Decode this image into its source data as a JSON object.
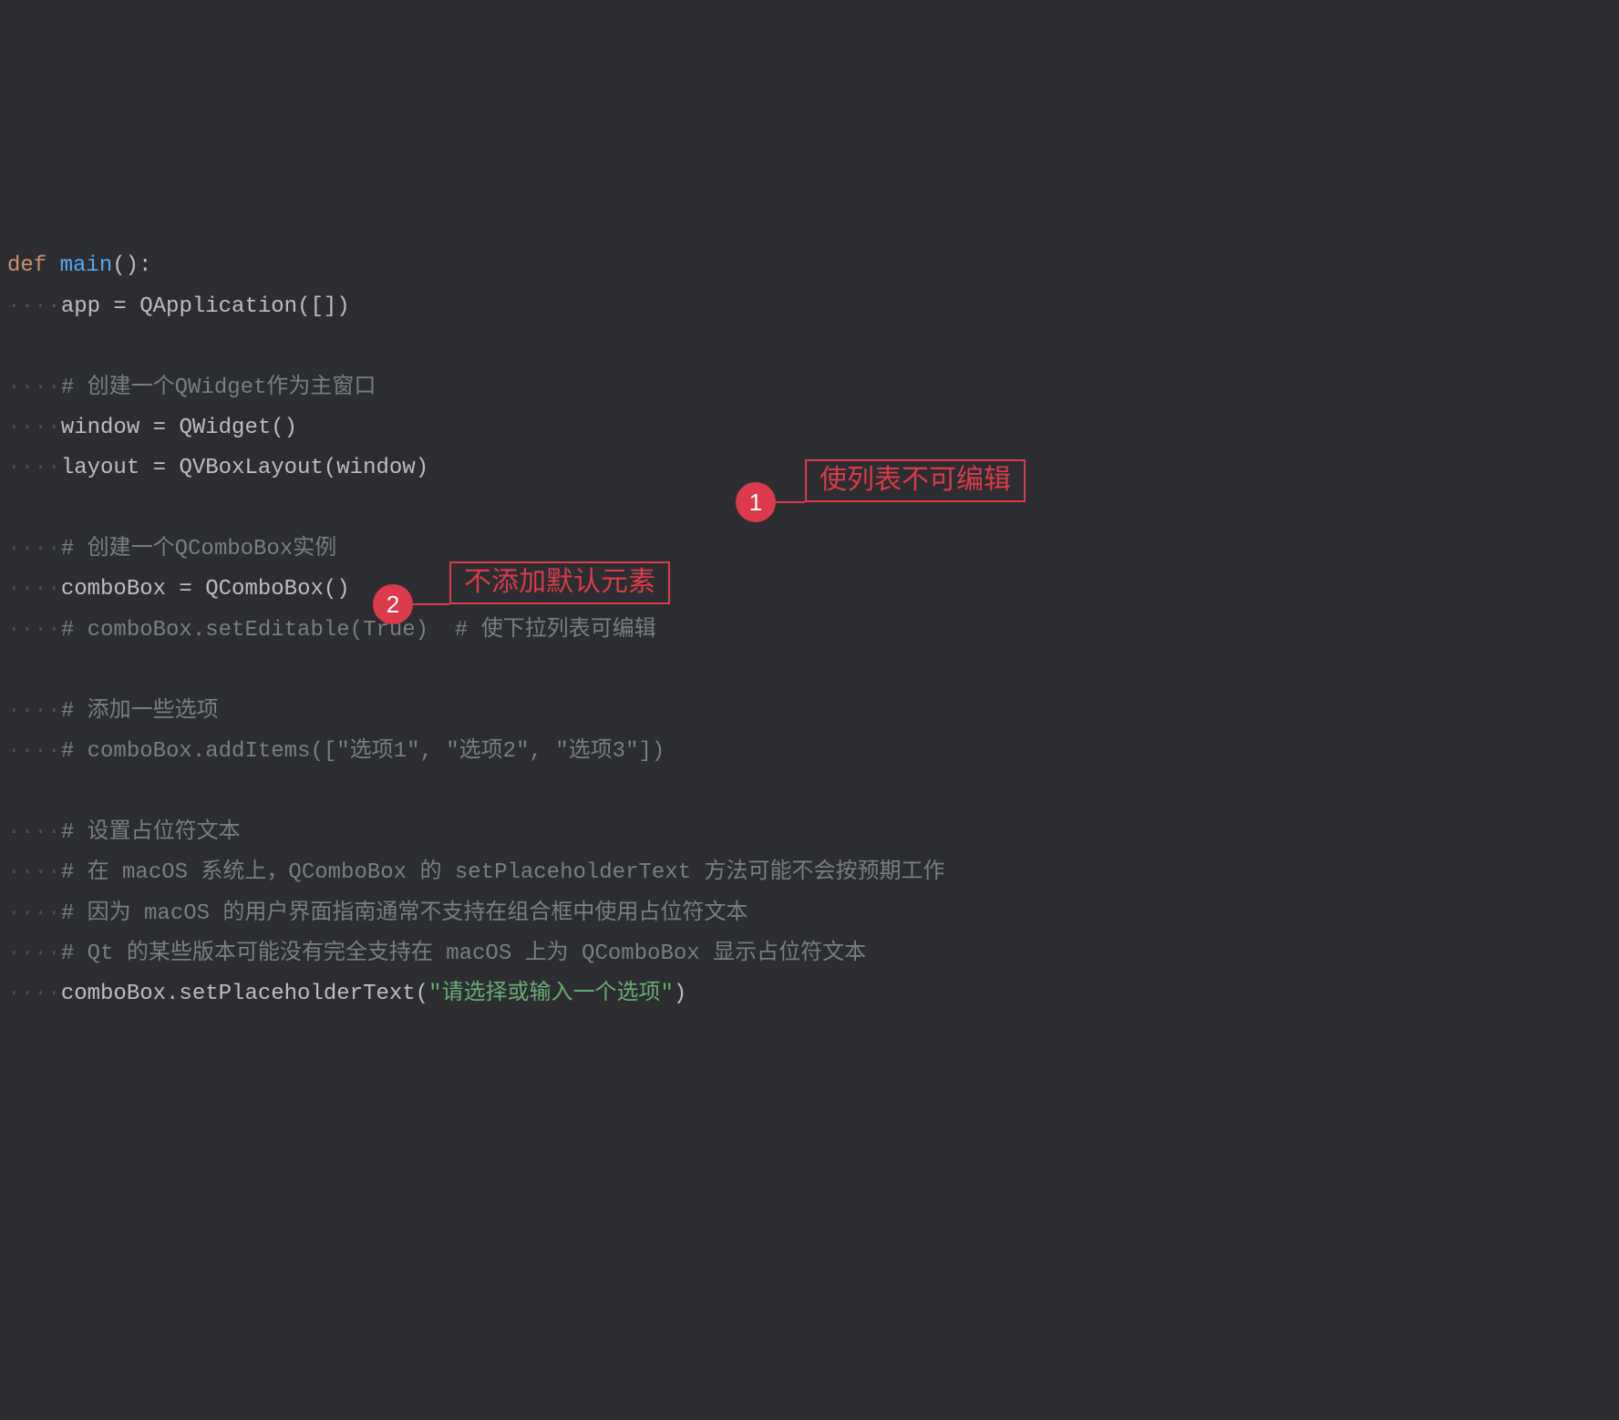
{
  "code": {
    "lines": [
      {
        "indent": 0,
        "tokens": [
          {
            "t": "keyword",
            "v": "def "
          },
          {
            "t": "funcname",
            "v": "main"
          },
          {
            "t": "paren",
            "v": "():"
          }
        ]
      },
      {
        "indent": 1,
        "tokens": [
          {
            "t": "plain",
            "v": "app = "
          },
          {
            "t": "classname",
            "v": "QApplication"
          },
          {
            "t": "paren",
            "v": "([])"
          }
        ]
      },
      {
        "indent": 0,
        "tokens": []
      },
      {
        "indent": 1,
        "tokens": [
          {
            "t": "comment",
            "v": "# 创建一个QWidget作为主窗口"
          }
        ]
      },
      {
        "indent": 1,
        "tokens": [
          {
            "t": "plain",
            "v": "window = "
          },
          {
            "t": "classname",
            "v": "QWidget"
          },
          {
            "t": "paren",
            "v": "()"
          }
        ]
      },
      {
        "indent": 1,
        "tokens": [
          {
            "t": "plain",
            "v": "layout = "
          },
          {
            "t": "classname",
            "v": "QVBoxLayout"
          },
          {
            "t": "paren",
            "v": "(window)"
          }
        ]
      },
      {
        "indent": 0,
        "tokens": []
      },
      {
        "indent": 1,
        "tokens": [
          {
            "t": "comment",
            "v": "# 创建一个QComboBox实例"
          }
        ]
      },
      {
        "indent": 1,
        "tokens": [
          {
            "t": "plain",
            "v": "comboBox = "
          },
          {
            "t": "classname",
            "v": "QComboBox"
          },
          {
            "t": "paren",
            "v": "()"
          }
        ]
      },
      {
        "indent": 1,
        "tokens": [
          {
            "t": "comment",
            "v": "# comboBox.setEditable(True)  # 使下拉列表可编辑"
          }
        ]
      },
      {
        "indent": 0,
        "tokens": []
      },
      {
        "indent": 1,
        "tokens": [
          {
            "t": "comment",
            "v": "# 添加一些选项"
          }
        ]
      },
      {
        "indent": 1,
        "tokens": [
          {
            "t": "comment",
            "v": "# comboBox.addItems([\"选项1\", \"选项2\", \"选项3\"])"
          }
        ]
      },
      {
        "indent": 0,
        "tokens": []
      },
      {
        "indent": 1,
        "tokens": [
          {
            "t": "comment",
            "v": "# 设置占位符文本"
          }
        ]
      },
      {
        "indent": 1,
        "tokens": [
          {
            "t": "comment",
            "v": "# 在 macOS 系统上，QComboBox 的 setPlaceholderText 方法可能不会按预期工作"
          }
        ]
      },
      {
        "indent": 1,
        "tokens": [
          {
            "t": "comment",
            "v": "# 因为 macOS 的用户界面指南通常不支持在组合框中使用占位符文本"
          }
        ]
      },
      {
        "indent": 1,
        "tokens": [
          {
            "t": "comment",
            "v": "# Qt 的某些版本可能没有完全支持在 macOS 上为 QComboBox 显示占位符文本"
          }
        ]
      },
      {
        "indent": 1,
        "tokens": [
          {
            "t": "plain",
            "v": "comboBox.setPlaceholderText("
          },
          {
            "t": "string",
            "v": "\"请选择或输入一个选项\""
          },
          {
            "t": "paren",
            "v": ")"
          }
        ]
      }
    ]
  },
  "annotations": {
    "a1": {
      "number": "1",
      "text": "使列表不可编辑"
    },
    "a2": {
      "number": "2",
      "text": "不添加默认元素"
    }
  }
}
